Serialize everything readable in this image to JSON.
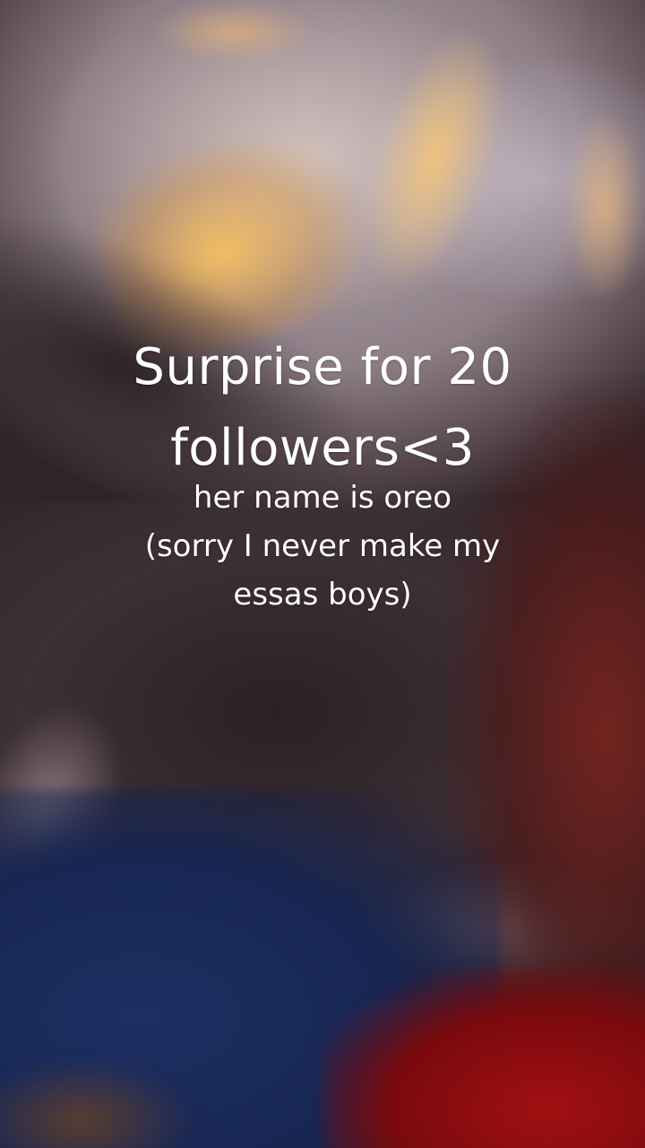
{
  "overlay": {
    "title_lines": [
      "Surprise for 20",
      "followers<3"
    ],
    "subtitle_lines": [
      "her name is oreo",
      "(sorry I never make my",
      "essas boys)"
    ]
  },
  "scene": {
    "description_colors": {
      "foil": "#b7aab1",
      "gold_highlight": "#ffc45a",
      "blue_bag": "#1d2f63",
      "red_object": "#a10f12"
    }
  }
}
